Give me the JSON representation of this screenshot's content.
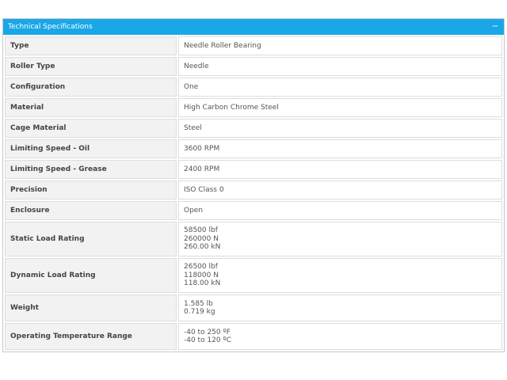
{
  "panel": {
    "title": "Technical Specifications",
    "collapse_symbol": "−"
  },
  "specs": [
    {
      "label": "Type",
      "values": [
        "Needle Roller Bearing"
      ]
    },
    {
      "label": "Roller Type",
      "values": [
        "Needle"
      ]
    },
    {
      "label": "Configuration",
      "values": [
        "One"
      ]
    },
    {
      "label": "Material",
      "values": [
        "High Carbon Chrome Steel"
      ]
    },
    {
      "label": "Cage Material",
      "values": [
        "Steel"
      ]
    },
    {
      "label": "Limiting Speed - Oil",
      "values": [
        "3600 RPM"
      ]
    },
    {
      "label": "Limiting Speed - Grease",
      "values": [
        "2400 RPM"
      ]
    },
    {
      "label": "Precision",
      "values": [
        "ISO Class 0"
      ]
    },
    {
      "label": "Enclosure",
      "values": [
        "Open"
      ]
    },
    {
      "label": "Static Load Rating",
      "values": [
        "58500 lbf",
        "260000 N",
        "260.00 kN"
      ]
    },
    {
      "label": "Dynamic Load Rating",
      "values": [
        "26500 lbf",
        "118000 N",
        "118.00 kN"
      ]
    },
    {
      "label": "Weight",
      "values": [
        "1.585 lb",
        "0.719 kg"
      ]
    },
    {
      "label": "Operating Temperature Range",
      "values": [
        "-40 to 250 ºF",
        "-40 to 120 ºC"
      ]
    }
  ]
}
